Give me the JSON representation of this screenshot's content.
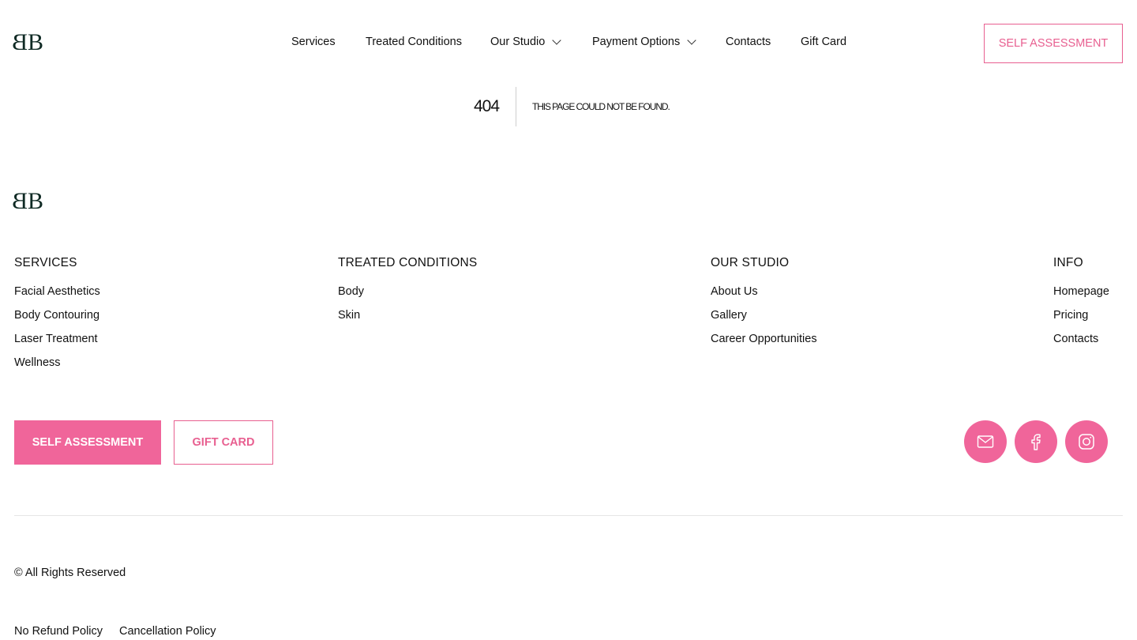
{
  "brand": {
    "logo_text": "BB",
    "accent_color": "#f0659a"
  },
  "header": {
    "nav": [
      {
        "label": "Services"
      },
      {
        "label": "Treated Conditions"
      },
      {
        "label": "Our Studio",
        "has_dropdown": true
      },
      {
        "label": "Payment Options",
        "has_dropdown": true
      },
      {
        "label": "Contacts"
      },
      {
        "label": "Gift Card"
      }
    ],
    "cta_label": "SELF ASSESSMENT"
  },
  "error": {
    "code": "404",
    "message": "THIS PAGE COULD NOT BE FOUND."
  },
  "footer": {
    "columns": [
      {
        "title": "SERVICES",
        "links": [
          "Facial Aesthetics",
          "Body Contouring",
          "Laser Treatment",
          "Wellness"
        ]
      },
      {
        "title": "TREATED CONDITIONS",
        "links": [
          "Body",
          "Skin"
        ]
      },
      {
        "title": "OUR STUDIO",
        "links": [
          "About Us",
          "Gallery",
          "Career Opportunities"
        ]
      },
      {
        "title": "INFO",
        "links": [
          "Homepage",
          "Pricing",
          "Contacts"
        ]
      }
    ],
    "primary_button": "SELF ASSESSMENT",
    "secondary_button": "GIFT CARD",
    "social_icons": [
      "mail-icon",
      "facebook-icon",
      "instagram-icon"
    ],
    "copyright": "© All Rights Reserved",
    "policies": [
      "No Refund Policy",
      "Cancellation Policy"
    ]
  }
}
